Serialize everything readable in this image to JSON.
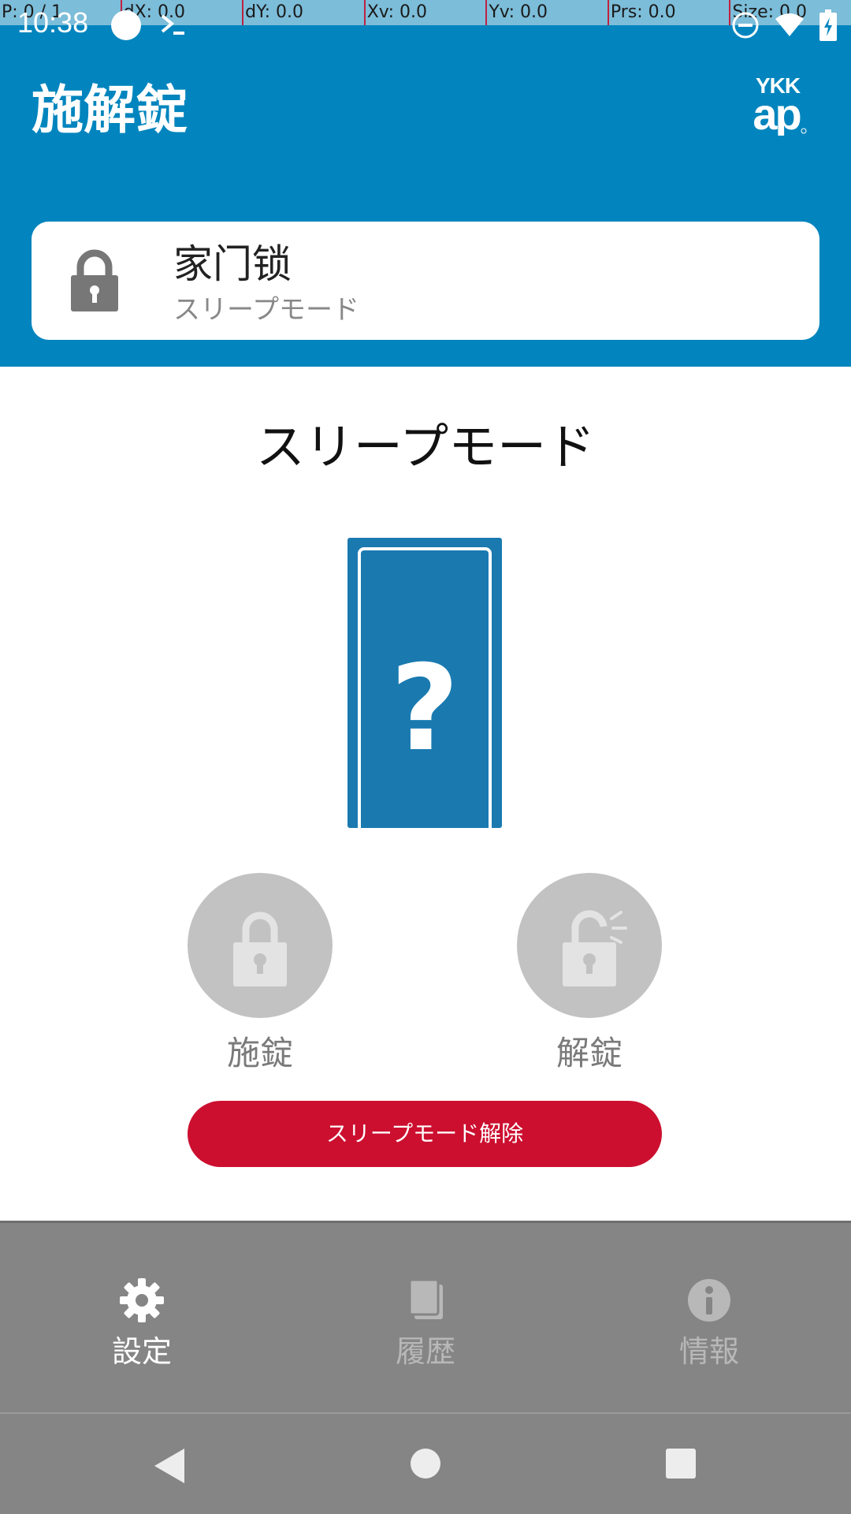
{
  "debug": {
    "pointer": "P: 0 / 1",
    "dx": "dX: 0.0",
    "dy": "dY: 0.0",
    "xv": "Xv: 0.0",
    "yv": "Yv: 0.0",
    "prs": "Prs: 0.0",
    "size": "Size: 0.0"
  },
  "status_bar": {
    "time": "10:38",
    "icons": [
      "record-icon",
      "terminal-icon",
      "dnd-icon",
      "wifi-icon",
      "battery-charging-icon"
    ]
  },
  "header": {
    "title": "施解錠",
    "logo_top": "YKK",
    "logo_bottom": "ap"
  },
  "device": {
    "name": "家门锁",
    "status": "スリープモード",
    "icon": "lock-icon"
  },
  "main": {
    "mode_title": "スリープモード",
    "door_icon": "door-unknown-icon",
    "door_symbol": "?",
    "lock_label": "施錠",
    "unlock_label": "解錠",
    "release_button": "スリープモード解除"
  },
  "tabs": [
    {
      "label": "設定",
      "icon": "gear-icon",
      "active": true
    },
    {
      "label": "履歴",
      "icon": "history-icon",
      "active": false
    },
    {
      "label": "情報",
      "icon": "info-icon",
      "active": false
    }
  ],
  "colors": {
    "header": "#0285be",
    "door": "#1a7ab0",
    "action_disabled": "#c2c2c2",
    "release_button": "#cc0f2f",
    "tab_bar": "#858585"
  }
}
